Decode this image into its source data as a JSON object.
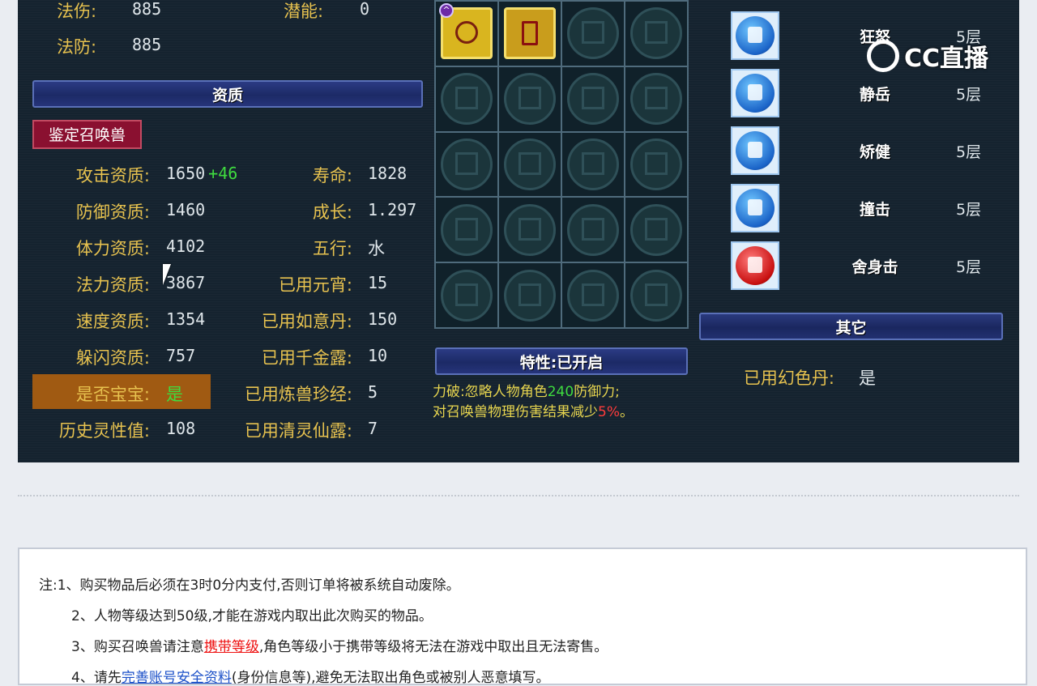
{
  "top_attrs": [
    {
      "label": "法伤:",
      "value": "885"
    },
    {
      "label": "法防:",
      "value": "885"
    }
  ],
  "potential": {
    "label": "潜能:",
    "value": "0"
  },
  "aptitude_header": "资质",
  "appraise_button": "鉴定召唤兽",
  "left_stats": [
    {
      "label": "攻击资质:",
      "value": "1650",
      "bonus": "+46"
    },
    {
      "label": "防御资质:",
      "value": "1460"
    },
    {
      "label": "体力资质:",
      "value": "4102"
    },
    {
      "label": "法力资质:",
      "value": "3867"
    },
    {
      "label": "速度资质:",
      "value": "1354"
    },
    {
      "label": "躲闪资质:",
      "value": "757"
    },
    {
      "label": "是否宝宝:",
      "value": "是"
    },
    {
      "label": "历史灵性值:",
      "value": "108"
    }
  ],
  "right_stats": [
    {
      "label": "寿命:",
      "value": "1828"
    },
    {
      "label": "成长:",
      "value": "1.297"
    },
    {
      "label": "五行:",
      "value": "水"
    },
    {
      "label": "已用元宵:",
      "value": "15"
    },
    {
      "label": "已用如意丹:",
      "value": "150"
    },
    {
      "label": "已用千金露:",
      "value": "10"
    },
    {
      "label": "已用炼兽珍经:",
      "value": "5"
    },
    {
      "label": "已用清灵仙露:",
      "value": "7"
    }
  ],
  "trait_header": "特性:已开启",
  "trait": {
    "prefix": "力破:忽略人物角色",
    "num1": "240",
    "mid": "防御力;",
    "line2_prefix": "对召唤兽物理伤害结果减少",
    "num2": "5%",
    "suffix": "。"
  },
  "buffs": [
    {
      "name": "狂怒",
      "level": "5层",
      "icon": "rage-icon"
    },
    {
      "name": "静岳",
      "level": "5层",
      "icon": "still-mountain-icon"
    },
    {
      "name": "矫健",
      "level": "5层",
      "icon": "agile-icon"
    },
    {
      "name": "撞击",
      "level": "5层",
      "icon": "strike-icon"
    },
    {
      "name": "舍身击",
      "level": "5层",
      "icon": "sacrifice-strike-icon"
    }
  ],
  "other_header": "其它",
  "other": {
    "label": "已用幻色丹:",
    "value": "是"
  },
  "logo": "CC直播",
  "notice": {
    "line1": "注:1、购买物品后必须在3时0分内支付,否则订单将被系统自动废除。",
    "line2": "2、人物等级达到50级,才能在游戏内取出此次购买的物品。",
    "line3_prefix": "3、购买召唤兽请注意",
    "line3_link": "携带等级",
    "line3_suffix": ",角色等级小于携带等级将无法在游戏中取出且无法寄售。",
    "line4_prefix": "4、请先",
    "line4_link": "完善账号安全资料",
    "line4_suffix": "(身份信息等),避免无法取出角色或被别人恶意填写。"
  }
}
